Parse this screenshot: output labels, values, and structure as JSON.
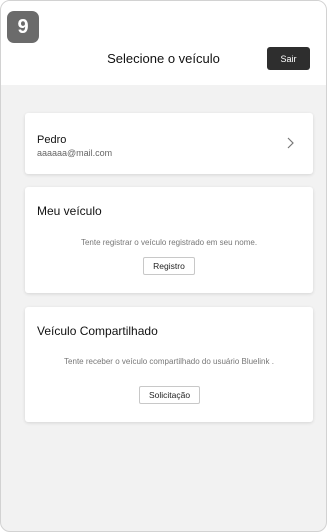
{
  "step_badge": "9",
  "header": {
    "title": "Selecione o veículo",
    "logout_label": "Sair"
  },
  "user": {
    "name": "Pedro",
    "email": "aaaaaa@mail.com"
  },
  "my_vehicle": {
    "title": "Meu veículo",
    "description": "Tente registrar o veículo registrado em seu nome.",
    "button_label": "Registro"
  },
  "shared_vehicle": {
    "title": "Veículo Compartilhado",
    "description": "Tente receber o veículo compartilhado do usuário Bluelink .",
    "button_label": "Solicitação"
  }
}
